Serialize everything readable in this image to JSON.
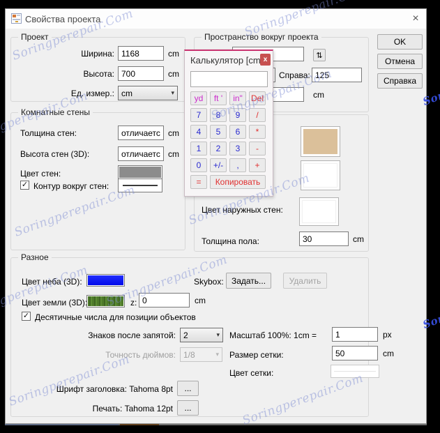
{
  "window": {
    "title": "Свойства проекта"
  },
  "actions": {
    "ok": "OK",
    "cancel": "Отмена",
    "help": "Справка"
  },
  "glyphs": {
    "close": "×",
    "check": "✓",
    "arrow": "▾",
    "link": "⇅"
  },
  "project": {
    "title": "Проект",
    "width_label": "Ширина:",
    "width_value": "1168",
    "width_unit": "cm",
    "height_label": "Высота:",
    "height_value": "700",
    "height_unit": "cm",
    "units_label": "Ед. измер.:",
    "units_value": "cm"
  },
  "room_walls": {
    "title": "Комнатные стены",
    "thickness_label": "Толщина стен:",
    "thickness_value": "отличается.",
    "thickness_unit": "cm",
    "height_label": "Высота стен (3D):",
    "height_value": "отличается.",
    "height_unit": "cm",
    "color_label": "Цвет стен:",
    "outline_label": "Контур вокруг стен:"
  },
  "space_around": {
    "title": "Пространство вокруг проекта",
    "right_label": "Справа:",
    "right_value": "125",
    "unit": "cm"
  },
  "exterior": {
    "wall_color_label": "Цвет наружных стен:",
    "floor_label": "Толщина пола:",
    "floor_value": "30",
    "floor_unit": "cm"
  },
  "misc": {
    "title": "Разное",
    "sky_label": "Цвет неба (3D):",
    "skybox_label": "Skybox:",
    "skybox_set": "Задать...",
    "skybox_remove": "Удалить",
    "ground_label": "Цвет земли (3D):",
    "z_label": "z:",
    "z_value": "0",
    "z_unit": "cm",
    "decimal_checkbox": "Десятичные числа для позиции объектов",
    "decimals_label": "Знаков после запятой:",
    "decimals_value": "2",
    "inch_label": "Точность дюймов:",
    "inch_value": "1/8",
    "scale_label": "Масштаб 100%: 1cm =",
    "scale_value": "1",
    "scale_unit": "px",
    "grid_size_label": "Размер сетки:",
    "grid_size_value": "50",
    "grid_size_unit": "cm",
    "grid_color_label": "Цвет сетки:",
    "header_font_label": "Шрифт заголовка: Tahoma 8pt",
    "print_font_label": "Печать: Tahoma 12pt",
    "ellipsis": "..."
  },
  "calculator": {
    "title": "Калькулятор [cm]",
    "close": "x",
    "display": "",
    "rows": [
      [
        {
          "t": "yd",
          "c": "unit"
        },
        {
          "t": "ft '",
          "c": "unit"
        },
        {
          "t": "in\"",
          "c": "unit"
        },
        {
          "t": "Del",
          "c": "op"
        }
      ],
      [
        {
          "t": "7",
          "c": "num"
        },
        {
          "t": "8",
          "c": "num"
        },
        {
          "t": "9",
          "c": "num"
        },
        {
          "t": "/",
          "c": "op"
        }
      ],
      [
        {
          "t": "4",
          "c": "num"
        },
        {
          "t": "5",
          "c": "num"
        },
        {
          "t": "6",
          "c": "num"
        },
        {
          "t": "*",
          "c": "op"
        }
      ],
      [
        {
          "t": "1",
          "c": "num"
        },
        {
          "t": "2",
          "c": "num"
        },
        {
          "t": "3",
          "c": "num"
        },
        {
          "t": "-",
          "c": "op"
        }
      ],
      [
        {
          "t": "0",
          "c": "num"
        },
        {
          "t": "+/-",
          "c": "num"
        },
        {
          "t": ",",
          "c": "num"
        },
        {
          "t": "+",
          "c": "op"
        }
      ],
      [
        {
          "t": "=",
          "c": "op"
        },
        {
          "t": "Копировать",
          "c": "op",
          "w": true
        }
      ]
    ]
  },
  "watermark": "Soringperepair.Com",
  "colors": {
    "sky_swatch": "#0b16f2",
    "ground_swatch": "#4e7a2a",
    "wall_swatch": "#8c8c8c",
    "floor_swatch": "#dbc09a",
    "calc_accent": "#c9326f",
    "calc_num": "#2a2ad0",
    "calc_unit": "#cc2ccc",
    "calc_op": "#e03030"
  }
}
